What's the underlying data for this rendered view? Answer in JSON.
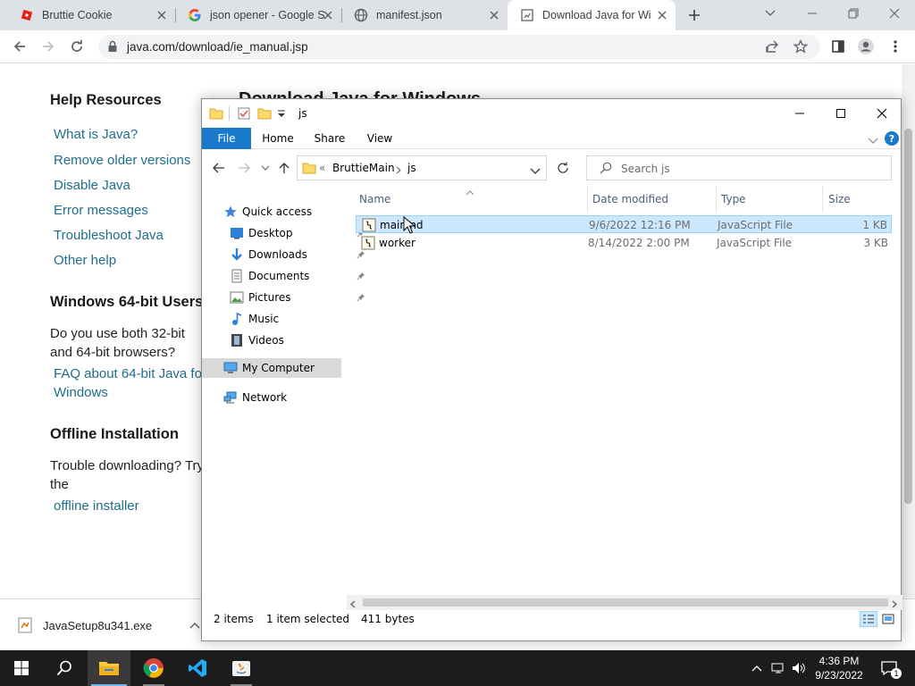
{
  "browser": {
    "tabs": [
      {
        "title": "Bruttie Cookie"
      },
      {
        "title": "json opener - Google S"
      },
      {
        "title": "manifest.json"
      },
      {
        "title": "Download Java for Wi"
      }
    ],
    "url": "java.com/download/ie_manual.jsp"
  },
  "page": {
    "heading_partial": "Download Java for Windows",
    "sidebar": {
      "help_heading": "Help Resources",
      "links": [
        "What is Java?",
        "Remove older versions",
        "Disable Java",
        "Error messages",
        "Troubleshoot Java",
        "Other help"
      ],
      "win64_heading": "Windows 64-bit Users",
      "win64_text_1": "Do you use both 32-bit",
      "win64_text_2": "and 64-bit browsers?",
      "win64_link_1": "FAQ about 64-bit Java fo",
      "win64_link_2": "Windows",
      "offline_heading": "Offline Installation",
      "offline_text_1": "Trouble downloading? Try",
      "offline_text_2": "the",
      "offline_link": "offline installer"
    }
  },
  "download_shelf": {
    "filename": "JavaSetup8u341.exe"
  },
  "explorer": {
    "title": "js",
    "ribbon_tabs": [
      "File",
      "Home",
      "Share",
      "View"
    ],
    "breadcrumb": {
      "prefix": "«",
      "parent": "BruttieMain",
      "current": "js"
    },
    "search_placeholder": "Search js",
    "nav": {
      "quick_access": "Quick access",
      "items": [
        "Desktop",
        "Downloads",
        "Documents",
        "Pictures",
        "Music",
        "Videos"
      ],
      "my_computer": "My Computer",
      "network": "Network"
    },
    "columns": {
      "name": "Name",
      "date": "Date modified",
      "type": "Type",
      "size": "Size"
    },
    "files": [
      {
        "name": "mainind",
        "date": "9/6/2022 12:16 PM",
        "type": "JavaScript File",
        "size": "1 KB",
        "selected": true
      },
      {
        "name": "worker",
        "date": "8/14/2022 2:00 PM",
        "type": "JavaScript File",
        "size": "3 KB",
        "selected": false
      }
    ],
    "status": {
      "count": "2 items",
      "selection": "1 item selected",
      "bytes": "411 bytes"
    }
  },
  "taskbar": {
    "time": "4:36 PM",
    "date": "9/23/2022",
    "notification_count": "1"
  },
  "colors": {
    "chrome_tabstrip": "#dee1e6",
    "link_blue": "#1f6e8c",
    "file_tab_blue": "#1979ca",
    "selection": "#cce8ff",
    "taskbar": "#1c1c1c"
  }
}
